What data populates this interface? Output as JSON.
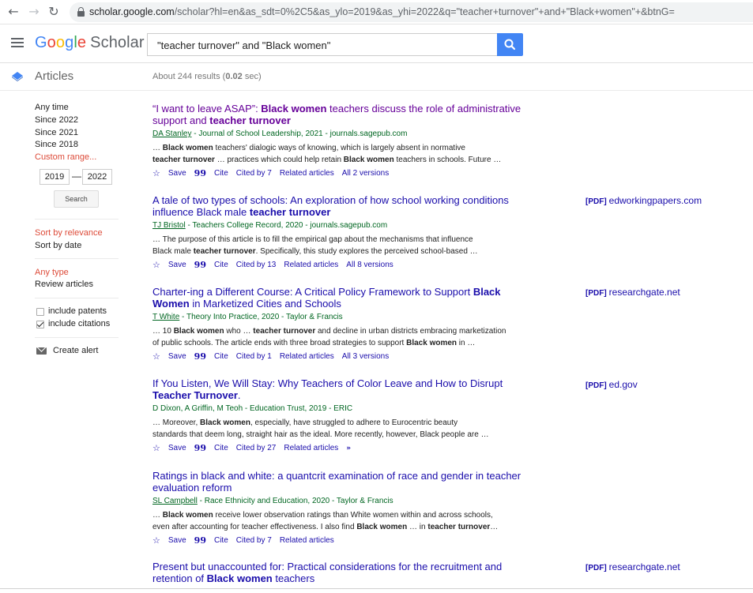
{
  "browser": {
    "url_host": "scholar.google.com",
    "url_path": "/scholar?hl=en&as_sdt=0%2C5&as_ylo=2019&as_yhi=2022&q=\"teacher+turnover\"+and+\"Black+women\"+&btnG="
  },
  "header": {
    "logo_google": [
      "G",
      "o",
      "o",
      "g",
      "l",
      "e"
    ],
    "logo_scholar": "Scholar",
    "search_query": "\"teacher turnover\" and \"Black women\""
  },
  "subheader": {
    "section": "Articles",
    "results_prefix": "About 244 results (",
    "results_time": "0.02",
    "results_suffix": " sec)"
  },
  "sidebar": {
    "time_filters": [
      "Any time",
      "Since 2022",
      "Since 2021",
      "Since 2018"
    ],
    "custom_range": "Custom range...",
    "year_from": "2019",
    "year_to": "2022",
    "dash": "—",
    "search_btn": "Search",
    "sort_relevance": "Sort by relevance",
    "sort_date": "Sort by date",
    "any_type": "Any type",
    "review_articles": "Review articles",
    "include_patents": "include patents",
    "include_citations": "include citations",
    "create_alert": "Create alert"
  },
  "results": [
    {
      "title_parts": [
        [
          "“I want to leave ASAP”: ",
          false
        ],
        [
          "Black women",
          true
        ],
        [
          " teachers discuss the role of administrative",
          false
        ]
      ],
      "title_line2": [
        [
          "support and ",
          false
        ],
        [
          "teacher turnover",
          true
        ]
      ],
      "author": "DA Stanley",
      "meta_rest": " - Journal of School Leadership, 2021 - journals.sagepub.com",
      "snip1": [
        [
          "… ",
          false
        ],
        [
          "Black women",
          true
        ],
        [
          " teachers' dialogic ways of knowing, which is largely absent in normative",
          false
        ]
      ],
      "snip2": [
        [
          "teacher turnover",
          true
        ],
        [
          " … practices which could help retain ",
          false
        ],
        [
          "Black women",
          true
        ],
        [
          " teachers in schools. Future …",
          false
        ]
      ],
      "save": "Save",
      "cite": "Cite",
      "cited_by": "Cited by 7",
      "related": "Related articles",
      "versions": "All 2 versions"
    },
    {
      "title_parts": [
        [
          "A tale of two types of schools: An exploration of how school working conditions",
          false
        ]
      ],
      "title_line2": [
        [
          "influence Black male ",
          false
        ],
        [
          "teacher turnover",
          true
        ]
      ],
      "author": "TJ Bristol",
      "meta_rest": " - Teachers College Record, 2020 - journals.sagepub.com",
      "snip1": [
        [
          "… The purpose of this article is to fill the empirical gap about the mechanisms that influence",
          false
        ]
      ],
      "snip2": [
        [
          "Black male ",
          false
        ],
        [
          "teacher turnover",
          true
        ],
        [
          ". Specifically, this study explores the perceived school-based …",
          false
        ]
      ],
      "save": "Save",
      "cite": "Cite",
      "cited_by": "Cited by 13",
      "related": "Related articles",
      "versions": "All 8 versions",
      "pdf_tag": "[PDF]",
      "pdf_host": "edworkingpapers.com"
    },
    {
      "title_parts": [
        [
          "Charter-ing a Different Course: A Critical Policy Framework to Support ",
          false
        ],
        [
          "Black",
          true
        ]
      ],
      "title_line2": [
        [
          "Women",
          true
        ],
        [
          " in Marketized Cities and Schools",
          false
        ]
      ],
      "author": "T White",
      "meta_rest": " - Theory Into Practice, 2020 - Taylor & Francis",
      "snip1": [
        [
          "… 10 ",
          false
        ],
        [
          "Black women",
          true
        ],
        [
          " who … ",
          false
        ],
        [
          "teacher turnover",
          true
        ],
        [
          " and decline in urban districts embracing marketization",
          false
        ]
      ],
      "snip2": [
        [
          "of public schools. The article ends with three broad strategies to support ",
          false
        ],
        [
          "Black women",
          true
        ],
        [
          " in …",
          false
        ]
      ],
      "save": "Save",
      "cite": "Cite",
      "cited_by": "Cited by 1",
      "related": "Related articles",
      "versions": "All 3 versions",
      "pdf_tag": "[PDF]",
      "pdf_host": "researchgate.net"
    },
    {
      "title_parts": [
        [
          "If You Listen, We Will Stay: Why Teachers of Color Leave and How to Disrupt",
          false
        ]
      ],
      "title_line2": [
        [
          "Teacher Turnover",
          true
        ],
        [
          ".",
          false
        ]
      ],
      "author": "",
      "meta_rest": "D Dixon, A Griffin, M Teoh - Education Trust, 2019 - ERIC",
      "snip1": [
        [
          "… Moreover, ",
          false
        ],
        [
          "Black women",
          true
        ],
        [
          ", especially, have struggled to adhere to Eurocentric beauty",
          false
        ]
      ],
      "snip2": [
        [
          "standards that deem long, straight hair as the ideal. More recently, however, Black people are …",
          false
        ]
      ],
      "save": "Save",
      "cite": "Cite",
      "cited_by": "Cited by 27",
      "related": "Related articles",
      "versions": "",
      "pdf_tag": "[PDF]",
      "pdf_host": "ed.gov"
    },
    {
      "title_parts": [
        [
          "Ratings in black and white: a quantcrit examination of race and gender in teacher",
          false
        ]
      ],
      "title_line2": [
        [
          "evaluation reform",
          false
        ]
      ],
      "author": "SL Campbell",
      "meta_rest": " - Race Ethnicity and Education, 2020 - Taylor & Francis",
      "snip1": [
        [
          "… ",
          false
        ],
        [
          "Black women",
          true
        ],
        [
          " receive lower observation ratings than White women within and across schools,",
          false
        ]
      ],
      "snip2": [
        [
          "even after accounting for teacher effectiveness. I also find ",
          false
        ],
        [
          "Black women",
          true
        ],
        [
          " … in ",
          false
        ],
        [
          "teacher turnover",
          true
        ],
        [
          "…",
          false
        ]
      ],
      "save": "Save",
      "cite": "Cite",
      "cited_by": "Cited by 7",
      "related": "Related articles",
      "versions": ""
    },
    {
      "title_parts": [
        [
          "Present but unaccounted for: Practical considerations for the recruitment and",
          false
        ]
      ],
      "title_line2": [
        [
          "retention of ",
          false
        ],
        [
          "Black women",
          true
        ],
        [
          " teachers",
          false
        ]
      ],
      "pdf_tag": "[PDF]",
      "pdf_host": "researchgate.net"
    }
  ]
}
